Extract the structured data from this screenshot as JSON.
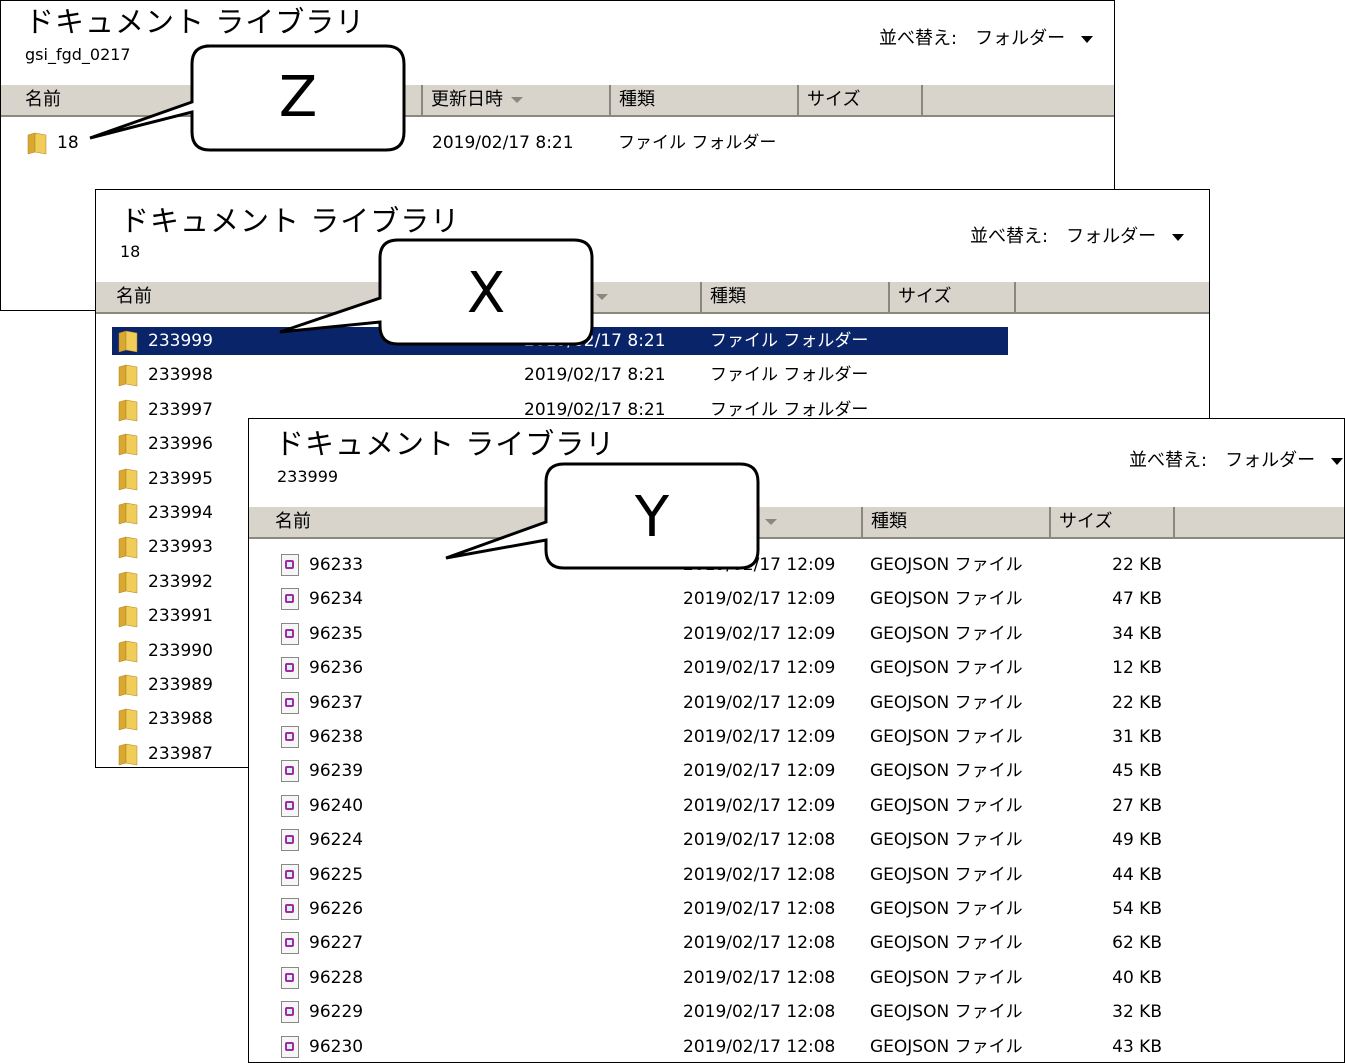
{
  "window_z": {
    "title": "ドキュメント ライブラリ",
    "path": "gsi_fgd_0217",
    "sort_label": "並べ替え:",
    "sort_value": "フォルダー",
    "columns": [
      "名前",
      "更新日時",
      "種類",
      "サイズ"
    ],
    "rows": [
      {
        "name": "18",
        "date": "2019/02/17 8:21",
        "type": "ファイル フォルダー"
      }
    ]
  },
  "window_x": {
    "title": "ドキュメント ライブラリ",
    "path": "18",
    "sort_label": "並べ替え:",
    "sort_value": "フォルダー",
    "columns": [
      "名前",
      "種類",
      "サイズ"
    ],
    "rows": [
      {
        "name": "233999",
        "date": "2019/02/17 8:21",
        "type": "ファイル フォルダー",
        "selected": true
      },
      {
        "name": "233998",
        "date": "2019/02/17 8:21",
        "type": "ファイル フォルダー"
      },
      {
        "name": "233997",
        "date": "2019/02/17 8:21",
        "type": "ファイル フォルダー"
      },
      {
        "name": "233996"
      },
      {
        "name": "233995"
      },
      {
        "name": "233994"
      },
      {
        "name": "233993"
      },
      {
        "name": "233992"
      },
      {
        "name": "233991"
      },
      {
        "name": "233990"
      },
      {
        "name": "233989"
      },
      {
        "name": "233988"
      },
      {
        "name": "233987"
      }
    ]
  },
  "window_y": {
    "title": "ドキュメント ライブラリ",
    "path": "233999",
    "sort_label": "並べ替え:",
    "sort_value": "フォルダー",
    "columns": [
      "名前",
      "種類",
      "サイズ"
    ],
    "rows": [
      {
        "name": "96233",
        "date": "2019/02/17 12:09",
        "type": "GEOJSON ファイル",
        "size": "22 KB"
      },
      {
        "name": "96234",
        "date": "2019/02/17 12:09",
        "type": "GEOJSON ファイル",
        "size": "47 KB"
      },
      {
        "name": "96235",
        "date": "2019/02/17 12:09",
        "type": "GEOJSON ファイル",
        "size": "34 KB"
      },
      {
        "name": "96236",
        "date": "2019/02/17 12:09",
        "type": "GEOJSON ファイル",
        "size": "12 KB"
      },
      {
        "name": "96237",
        "date": "2019/02/17 12:09",
        "type": "GEOJSON ファイル",
        "size": "22 KB"
      },
      {
        "name": "96238",
        "date": "2019/02/17 12:09",
        "type": "GEOJSON ファイル",
        "size": "31 KB"
      },
      {
        "name": "96239",
        "date": "2019/02/17 12:09",
        "type": "GEOJSON ファイル",
        "size": "45 KB"
      },
      {
        "name": "96240",
        "date": "2019/02/17 12:09",
        "type": "GEOJSON ファイル",
        "size": "27 KB"
      },
      {
        "name": "96224",
        "date": "2019/02/17 12:08",
        "type": "GEOJSON ファイル",
        "size": "49 KB"
      },
      {
        "name": "96225",
        "date": "2019/02/17 12:08",
        "type": "GEOJSON ファイル",
        "size": "44 KB"
      },
      {
        "name": "96226",
        "date": "2019/02/17 12:08",
        "type": "GEOJSON ファイル",
        "size": "54 KB"
      },
      {
        "name": "96227",
        "date": "2019/02/17 12:08",
        "type": "GEOJSON ファイル",
        "size": "62 KB"
      },
      {
        "name": "96228",
        "date": "2019/02/17 12:08",
        "type": "GEOJSON ファイル",
        "size": "40 KB"
      },
      {
        "name": "96229",
        "date": "2019/02/17 12:08",
        "type": "GEOJSON ファイル",
        "size": "32 KB"
      },
      {
        "name": "96230",
        "date": "2019/02/17 12:08",
        "type": "GEOJSON ファイル",
        "size": "43 KB"
      }
    ]
  },
  "callouts": {
    "z": "Z",
    "x": "X",
    "y": "Y"
  },
  "colors": {
    "header_bg": "#d8d4cc",
    "selection_bg": "#0a246a",
    "folder_yellow": "#e8c048"
  }
}
